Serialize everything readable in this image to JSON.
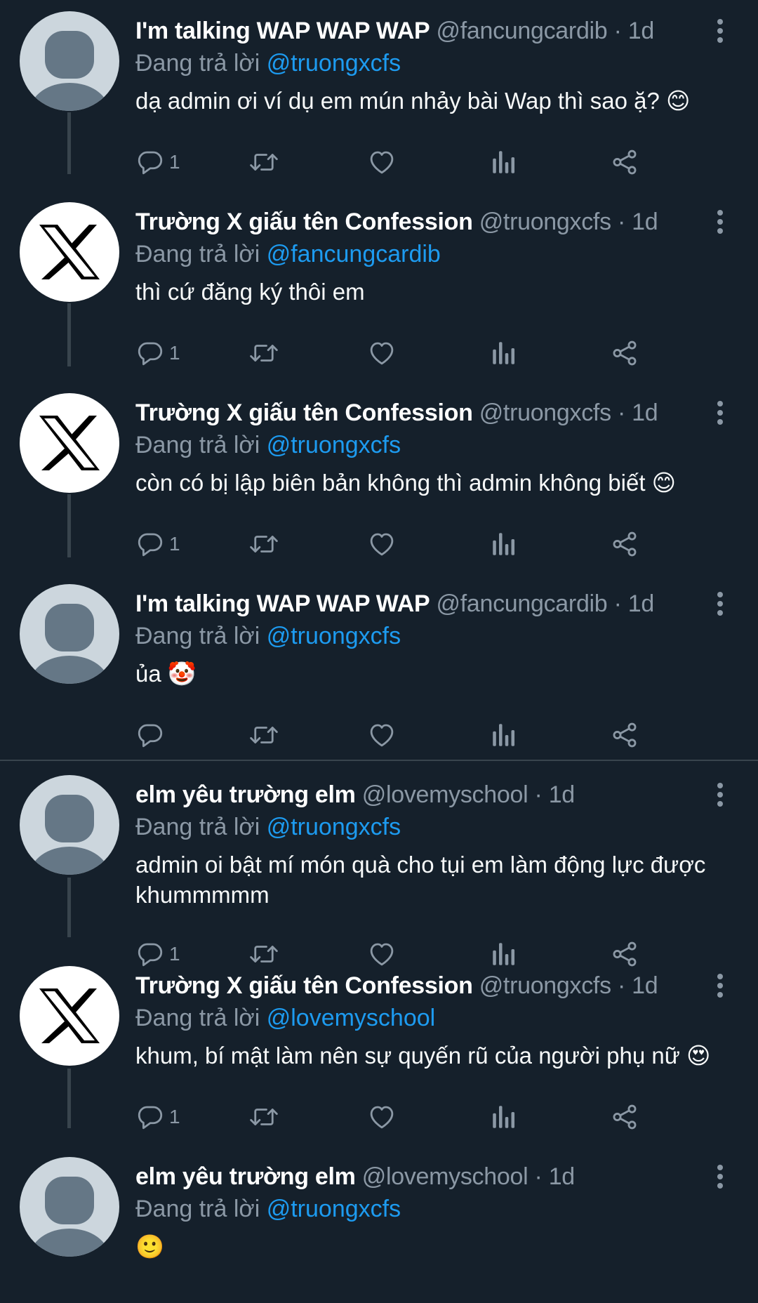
{
  "replying_prefix": "Đang trả lời",
  "separator_dot": "·",
  "tweets": [
    {
      "name": "I'm talking WAP WAP WAP",
      "handle": "@fancungcardib",
      "time": "1d",
      "replying_to": "@truongxcfs",
      "text": "dạ admin ơi ví dụ em mún nhảy bài Wap thì sao ặ? 😊",
      "reply_count": "1",
      "avatar": "default-avatar-icon"
    },
    {
      "name": "Trường X giấu tên Confession",
      "handle": "@truongxcfs",
      "time": "1d",
      "replying_to": "@fancungcardib",
      "text": "thì cứ đăng ký thôi em",
      "reply_count": "1",
      "avatar": "x-logo-icon"
    },
    {
      "name": "Trường X giấu tên Confession",
      "handle": "@truongxcfs",
      "time": "1d",
      "replying_to": "@truongxcfs",
      "text": "còn có bị lập biên bản không thì admin không biết 😊",
      "reply_count": "1",
      "avatar": "x-logo-icon"
    },
    {
      "name": "I'm talking WAP WAP WAP",
      "handle": "@fancungcardib",
      "time": "1d",
      "replying_to": "@truongxcfs",
      "text": "ủa 🤡",
      "reply_count": "",
      "avatar": "default-avatar-icon"
    },
    {
      "name": "elm yêu trường elm",
      "handle": "@lovemyschool",
      "time": "1d",
      "replying_to": "@truongxcfs",
      "text": "admin oi bật mí món quà cho tụi em làm động lực được khummmmm",
      "reply_count": "1",
      "avatar": "default-avatar-icon"
    },
    {
      "name": "Trường X giấu tên Confession",
      "handle": "@truongxcfs",
      "time": "1d",
      "replying_to": "@lovemyschool",
      "text": "khum, bí mật làm nên sự quyến rũ của người phụ nữ 😍",
      "reply_count": "1",
      "avatar": "x-logo-icon"
    },
    {
      "name": "elm yêu trường elm",
      "handle": "@lovemyschool",
      "time": "1d",
      "replying_to": "@truongxcfs",
      "text": "🙂",
      "reply_count": "",
      "avatar": "default-avatar-icon"
    }
  ],
  "colors": {
    "background": "#15202b",
    "text": "#f7f9f9",
    "secondary": "#8b98a5",
    "link": "#1d9bf0",
    "thread_line": "#38444d"
  }
}
